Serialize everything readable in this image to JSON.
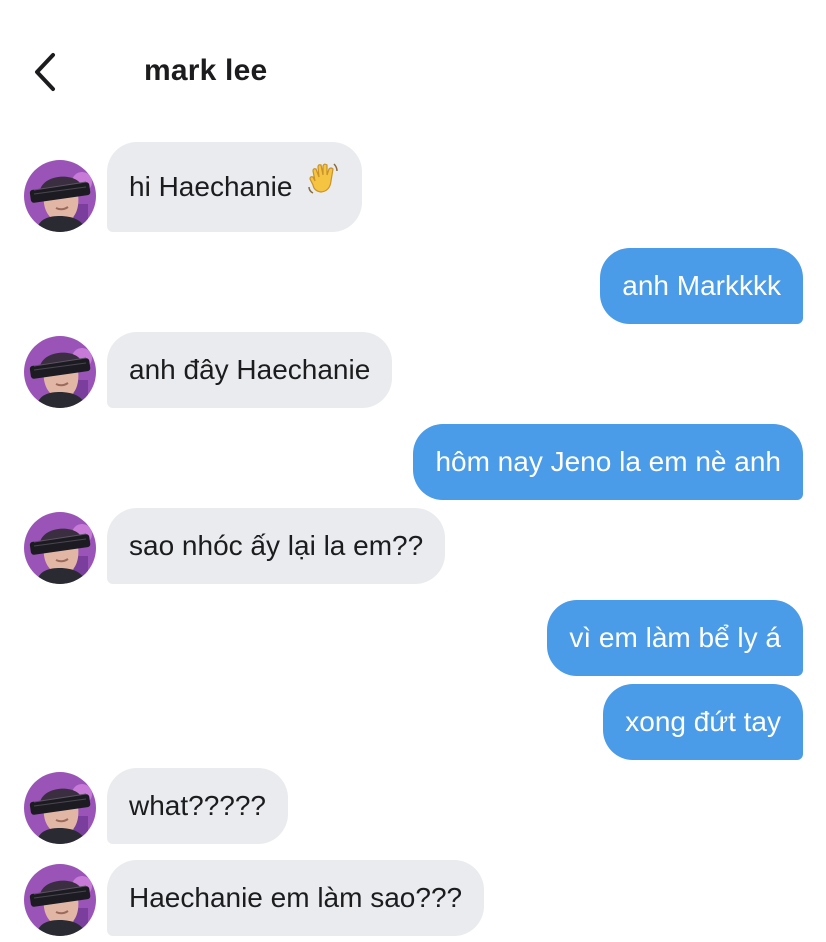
{
  "header": {
    "title": "mark lee"
  },
  "messages": [
    {
      "side": "in",
      "text": "hi Haechanie",
      "emoji": "waving-hand"
    },
    {
      "side": "out",
      "text": "anh Markkkk"
    },
    {
      "side": "in",
      "text": "anh đây Haechanie"
    },
    {
      "side": "out",
      "text": "hôm nay Jeno la em nè anh"
    },
    {
      "side": "in",
      "text": "sao nhóc ấy lại la em??"
    },
    {
      "side": "out",
      "text": "vì em làm bể ly á"
    },
    {
      "side": "out",
      "text": "xong đứt tay"
    },
    {
      "side": "in",
      "text": "what?????"
    },
    {
      "side": "in",
      "text": "Haechanie em làm sao???"
    }
  ],
  "colors": {
    "incoming_bubble": "#e9ebee",
    "outgoing_bubble": "#4a9be8",
    "outgoing_text": "#ffffff"
  }
}
